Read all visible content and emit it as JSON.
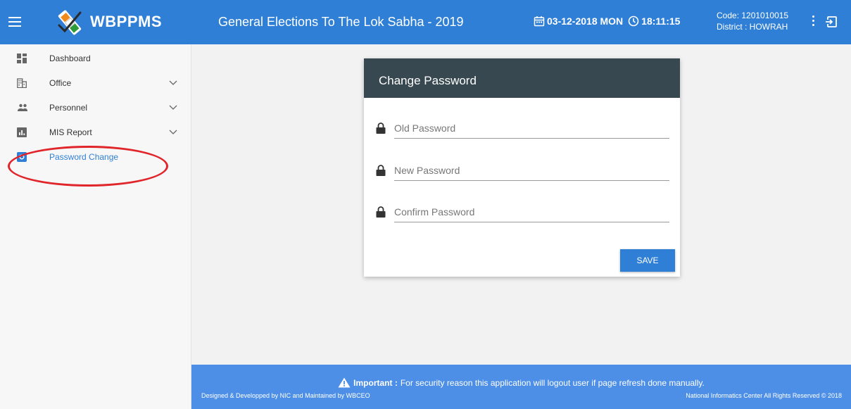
{
  "header": {
    "brand": "WBPPMS",
    "title": "General Elections To The Lok Sabha - 2019",
    "date": "03-12-2018 MON",
    "time": "18:11:15",
    "code": "Code: 1201010015",
    "district": "District : HOWRAH",
    "color": "#2f7fd6"
  },
  "sidebar": {
    "items": [
      {
        "label": "Dashboard",
        "icon": "dashboard-icon"
      },
      {
        "label": "Office",
        "icon": "office-building-icon",
        "expandable": true
      },
      {
        "label": "Personnel",
        "icon": "people-icon",
        "expandable": true
      },
      {
        "label": "MIS Report",
        "icon": "bar-chart-icon",
        "expandable": true
      },
      {
        "label": "Password Change",
        "icon": "password-reset-icon",
        "active": true
      }
    ]
  },
  "card": {
    "title": "Change Password",
    "fields": [
      {
        "placeholder": "Old Password",
        "value": ""
      },
      {
        "placeholder": "New Password",
        "value": ""
      },
      {
        "placeholder": "Confirm Password",
        "value": ""
      }
    ],
    "save_label": "SAVE"
  },
  "footer": {
    "important_label": "Important :",
    "important_text": "For security reason this application will logout user if page refresh done manually.",
    "left_text": "Designed & Developped by NIC and Maintained by WBCEO",
    "right_text": "National Informatics Center All Rights Reserved © 2018"
  },
  "colors": {
    "accent": "#2f7fd6",
    "card_header": "#374851",
    "footer": "#4d8fe6",
    "highlight_circle": "#e0252b"
  }
}
